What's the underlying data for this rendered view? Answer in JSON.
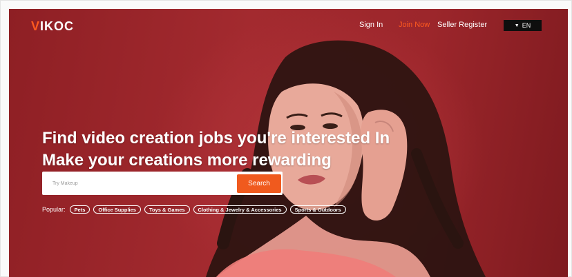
{
  "brand": {
    "logo_prefix": "V",
    "logo_rest": "IKOC"
  },
  "nav": {
    "sign_in": "Sign In",
    "join_now": "Join Now",
    "seller_register": "Seller Register",
    "language": "EN",
    "language_caret": "▼"
  },
  "hero": {
    "headline_line1": "Find video creation jobs you're interested In",
    "headline_line2": "Make your creations more rewarding"
  },
  "search": {
    "placeholder": "Try Makeup",
    "button_label": "Search"
  },
  "popular": {
    "label": "Popular:",
    "tags": [
      "Pets",
      "Office Supplies",
      "Toys & Games",
      "Clothing & Jewelry & Accessories",
      "Sports & Outdoors"
    ]
  },
  "colors": {
    "accent": "#f05a1e",
    "hero_background": "#a32a2f",
    "language_button": "#0e0e0e"
  }
}
